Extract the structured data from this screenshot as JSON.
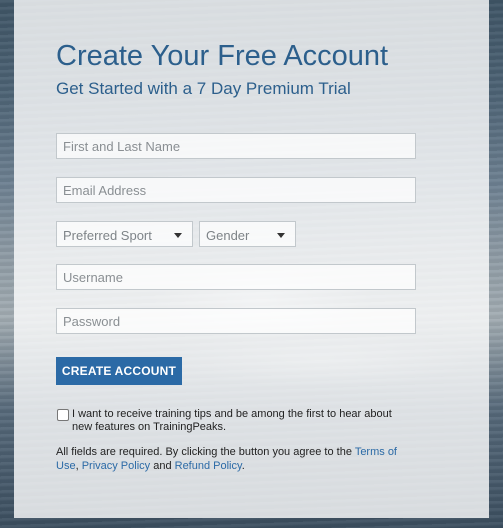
{
  "header": {
    "title": "Create Your Free Account",
    "subtitle": "Get Started with a 7 Day Premium Trial"
  },
  "form": {
    "name_placeholder": "First and Last Name",
    "email_placeholder": "Email Address",
    "sport_selected": "Preferred Sport",
    "gender_selected": "Gender",
    "username_placeholder": "Username",
    "password_placeholder": "Password",
    "submit_label": "CREATE ACCOUNT"
  },
  "newsletter": {
    "checked": false,
    "label_line1": "I want to receive training tips and be among the first to hear about",
    "label_line2": "new features on TrainingPeaks."
  },
  "legal": {
    "prefix": "All fields are required. By clicking the button you agree to the ",
    "terms_link": "Terms of Use",
    "sep1": ", ",
    "privacy_link": "Privacy Policy",
    "sep2": " and ",
    "refund_link": "Refund Policy",
    "suffix": "."
  },
  "colors": {
    "accent": "#2c5f8c",
    "button": "#2b6aa6",
    "link": "#2b6aa6"
  }
}
